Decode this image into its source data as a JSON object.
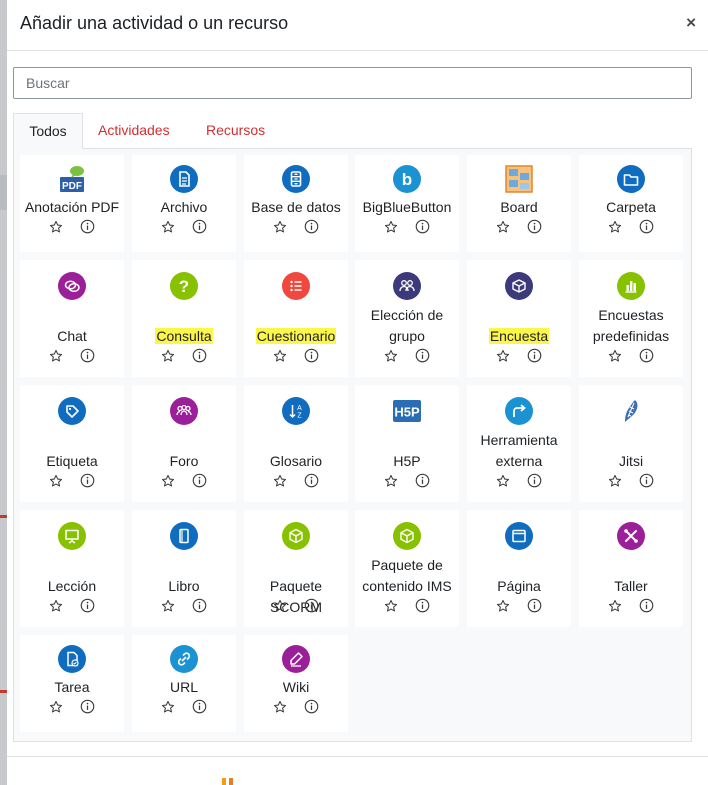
{
  "dialog": {
    "title": "Añadir una actividad o un recurso",
    "close_label": "×"
  },
  "search": {
    "placeholder": "Buscar",
    "value": ""
  },
  "tabs": [
    {
      "label": "Todos",
      "active": true
    },
    {
      "label": "Actividades",
      "active": false
    },
    {
      "label": "Recursos",
      "active": false
    }
  ],
  "colors": {
    "activity_blue": "#0f6cbf",
    "collaboration_purple": "#9c1f9a",
    "assessment_red": "#f0483e",
    "communication_green": "#88c100",
    "content_navy": "#3c3a7a",
    "link_red": "#d32f2f",
    "highlight_yellow": "#fcf54a"
  },
  "modules": [
    {
      "label": "Anotación PDF",
      "icon": "pdf-annotation-icon",
      "highlighted": false
    },
    {
      "label": "Archivo",
      "icon": "file-icon",
      "highlighted": false
    },
    {
      "label": "Base de datos",
      "icon": "database-icon",
      "highlighted": false
    },
    {
      "label": "BigBlueButton",
      "icon": "bigbluebutton-icon",
      "highlighted": false
    },
    {
      "label": "Board",
      "icon": "board-icon",
      "highlighted": false
    },
    {
      "label": "Carpeta",
      "icon": "folder-icon",
      "highlighted": false
    },
    {
      "label": "Chat",
      "icon": "chat-icon",
      "highlighted": false
    },
    {
      "label": "Consulta",
      "icon": "question-icon",
      "highlighted": true
    },
    {
      "label": "Cuestionario",
      "icon": "quiz-icon",
      "highlighted": true
    },
    {
      "label": "Elección de grupo",
      "icon": "group-choice-icon",
      "highlighted": false
    },
    {
      "label": "Encuesta",
      "icon": "survey-icon",
      "highlighted": true
    },
    {
      "label": "Encuestas predefinidas",
      "icon": "predefined-surveys-icon",
      "highlighted": false
    },
    {
      "label": "Etiqueta",
      "icon": "label-tag-icon",
      "highlighted": false
    },
    {
      "label": "Foro",
      "icon": "forum-icon",
      "highlighted": false
    },
    {
      "label": "Glosario",
      "icon": "glossary-icon",
      "highlighted": false
    },
    {
      "label": "H5P",
      "icon": "h5p-icon",
      "highlighted": false
    },
    {
      "label": "Herramienta externa",
      "icon": "external-tool-icon",
      "highlighted": false
    },
    {
      "label": "Jitsi",
      "icon": "jitsi-icon",
      "highlighted": false
    },
    {
      "label": "Lección",
      "icon": "lesson-icon",
      "highlighted": false
    },
    {
      "label": "Libro",
      "icon": "book-icon",
      "highlighted": false
    },
    {
      "label": "Paquete SCORM",
      "icon": "scorm-package-icon",
      "highlighted": false
    },
    {
      "label": "Paquete de contenido IMS",
      "icon": "ims-package-icon",
      "highlighted": false
    },
    {
      "label": "Página",
      "icon": "page-icon",
      "highlighted": false
    },
    {
      "label": "Taller",
      "icon": "workshop-icon",
      "highlighted": false
    },
    {
      "label": "Tarea",
      "icon": "assignment-icon",
      "highlighted": false
    },
    {
      "label": "URL",
      "icon": "url-icon",
      "highlighted": false
    },
    {
      "label": "Wiki",
      "icon": "wiki-icon",
      "highlighted": false
    }
  ]
}
